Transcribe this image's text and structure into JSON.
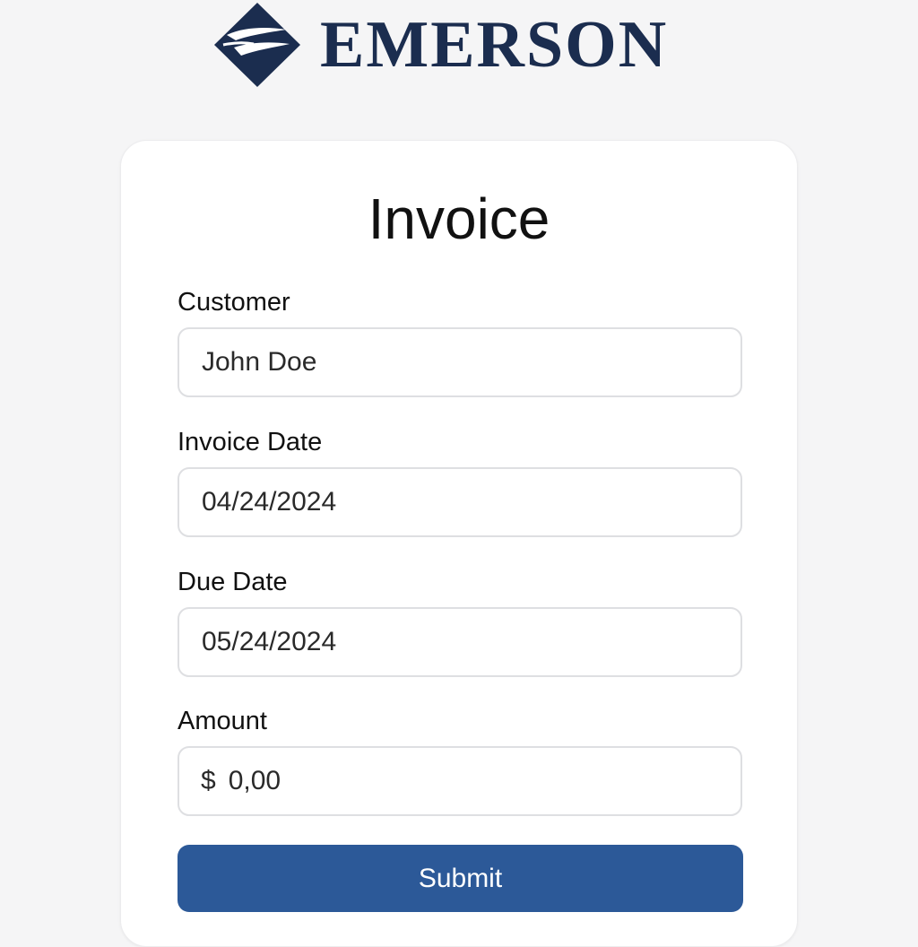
{
  "brand": {
    "name": "EMERSON",
    "color": "#1b2d4f",
    "icon": "emerson-diamond-logo-icon"
  },
  "form": {
    "title": "Invoice",
    "fields": {
      "customer": {
        "label": "Customer",
        "value": "John Doe"
      },
      "invoice_date": {
        "label": "Invoice Date",
        "value": "04/24/2024"
      },
      "due_date": {
        "label": "Due Date",
        "value": "05/24/2024"
      },
      "amount": {
        "label": "Amount",
        "currency": "$",
        "value": "0,00"
      }
    },
    "submit_label": "Submit"
  },
  "colors": {
    "background": "#f5f5f6",
    "card": "#ffffff",
    "input_border": "#dedfe2",
    "primary_button": "#2c5998"
  }
}
